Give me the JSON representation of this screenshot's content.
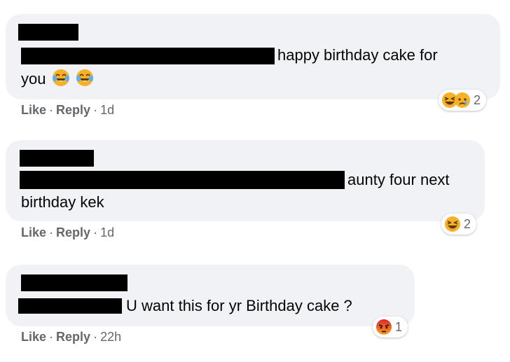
{
  "comments": [
    {
      "text_line1": "happy birthday cake for",
      "text_line2": "you",
      "inline_emojis": [
        "face-with-tears-of-joy",
        "face-with-tears-of-joy"
      ],
      "actions": {
        "like": "Like",
        "reply": "Reply",
        "time": "1d"
      },
      "reactions": {
        "icons": [
          "laughing-face",
          "sad-face"
        ],
        "count": "2"
      }
    },
    {
      "text_line1": "aunty four next",
      "text_line2": "birthday kek",
      "actions": {
        "like": "Like",
        "reply": "Reply",
        "time": "1d"
      },
      "reactions": {
        "icons": [
          "laughing-face"
        ],
        "count": "2"
      }
    },
    {
      "text_line1": "U want this for yr Birthday cake ?",
      "actions": {
        "like": "Like",
        "reply": "Reply",
        "time": "22h"
      },
      "reactions": {
        "icons": [
          "angry-face"
        ],
        "count": "1"
      }
    }
  ],
  "separator": "·",
  "colors": {
    "bubble": "#f0f2f5",
    "meta_text": "#65676b",
    "emoji_yellow": "#f7b125",
    "angry_red": "#e9710f",
    "redaction": "#000000"
  }
}
